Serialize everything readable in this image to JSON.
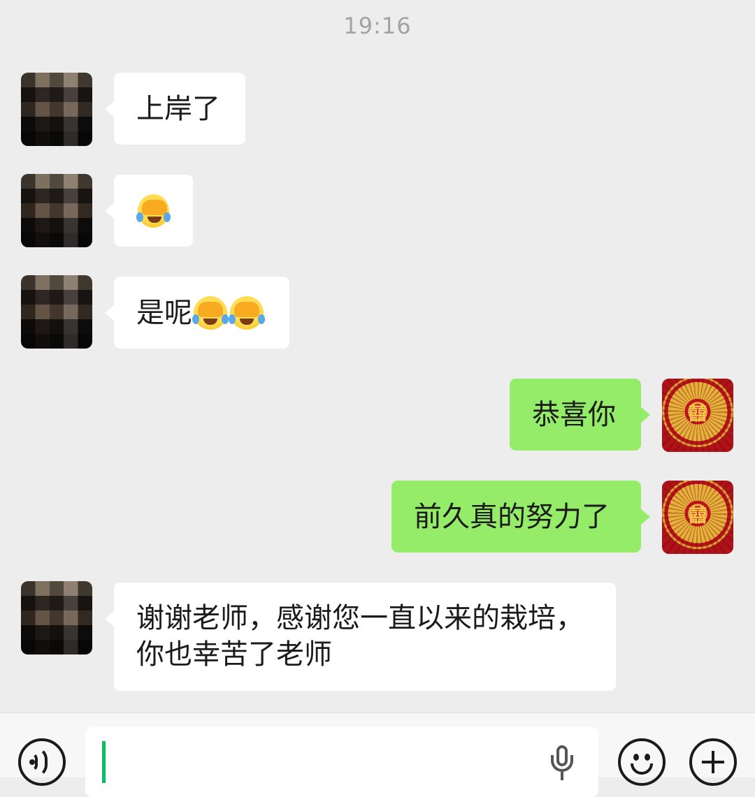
{
  "chat": {
    "timestamp": "19:16",
    "messages": [
      {
        "sender": "other",
        "text": "上岸了"
      },
      {
        "sender": "other",
        "emoji": "facepalm-laugh-emoji"
      },
      {
        "sender": "other",
        "text": "是呢",
        "emoji": "facepalm-laugh-emoji",
        "emoji_count": 2
      },
      {
        "sender": "self",
        "text": "恭喜你"
      },
      {
        "sender": "self",
        "text": "前久真的努力了"
      },
      {
        "sender": "other",
        "lines": [
          "谢谢老师，感谢您一直以来的栽培，",
          "你也幸苦了老师"
        ]
      }
    ]
  },
  "input_bar": {
    "voice_icon": "voice-toggle-icon",
    "text_value": "",
    "mic_icon": "microphone-icon",
    "emoji_icon": "smiley-icon",
    "more_icon": "plus-icon"
  },
  "colors": {
    "background": "#ededed",
    "incoming_bubble": "#ffffff",
    "outgoing_bubble": "#95ec69",
    "cursor": "#07c160"
  }
}
